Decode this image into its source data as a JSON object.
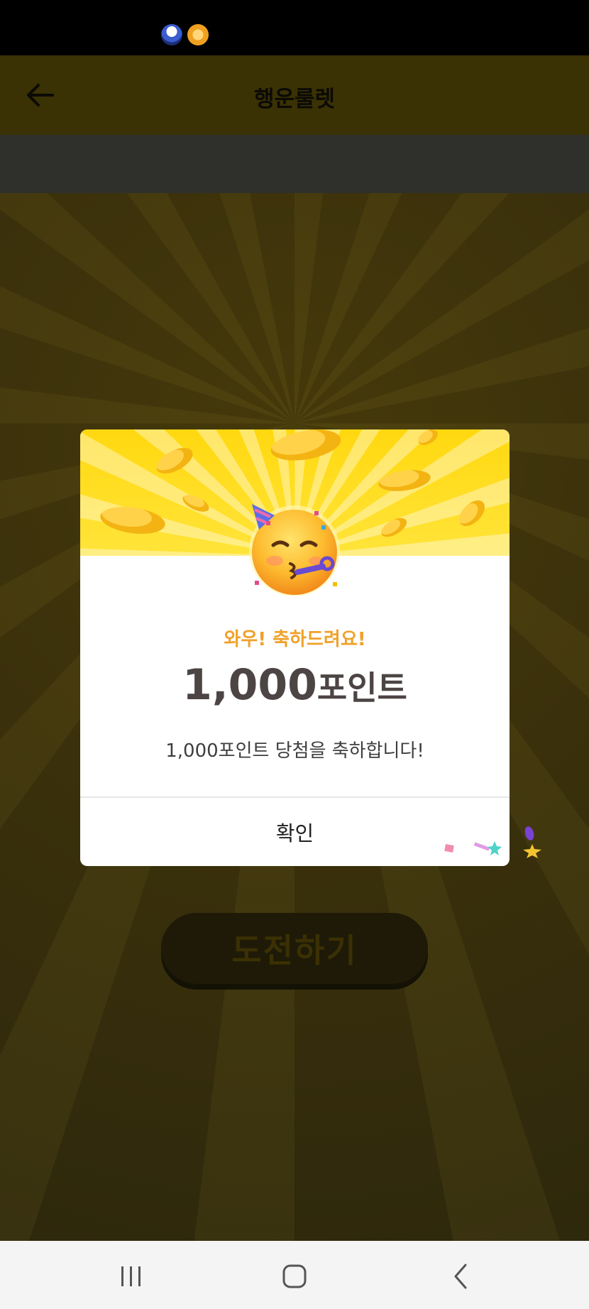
{
  "status_bar": {
    "icons": [
      "app-notification-icon",
      "coin-notification-icon"
    ]
  },
  "header": {
    "title": "행운룰렛",
    "back_icon": "arrow-left-icon"
  },
  "main": {
    "challenge_button_label": "도전하기"
  },
  "modal": {
    "emoji": "party-face-icon",
    "success_title": "와우! 축하드려요!",
    "prize_amount": "1,000",
    "prize_unit": "포인트",
    "prize_message": "1,000포인트 당첨을 축하합니다!",
    "confirm_label": "확인"
  },
  "nav_bar": {
    "buttons": [
      "recent-apps-icon",
      "home-icon",
      "back-icon"
    ]
  },
  "colors": {
    "header_bg": "#3a3104",
    "overlay_bg": "#3a300b",
    "modal_top": "#ffdc1e",
    "title_accent": "#f0a12a",
    "prize_text": "#4d4444"
  }
}
